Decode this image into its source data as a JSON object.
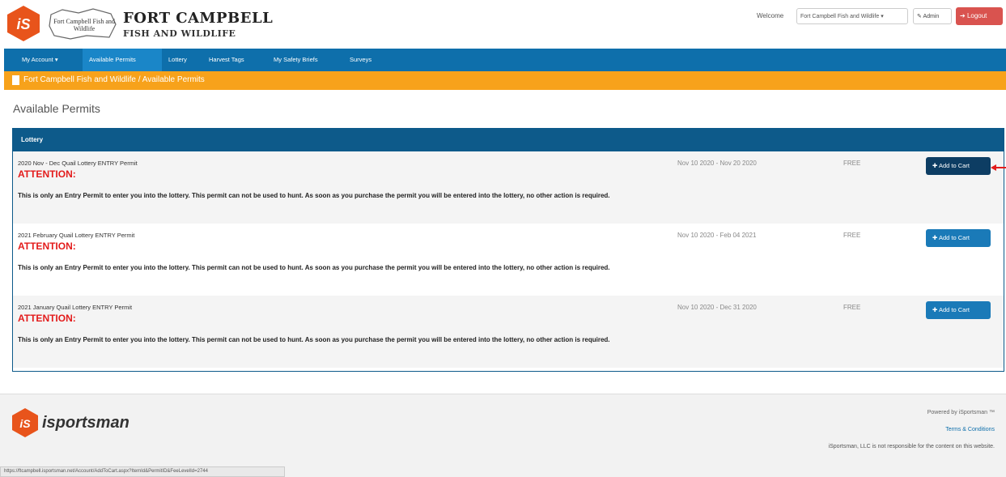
{
  "header": {
    "map_label": "Fort Campbell Fish and Wildlife",
    "title_line1": "FORT CAMPBELL",
    "title_line2": "FISH AND WILDLIFE",
    "welcome_label": "Welcome",
    "account_select": "Fort Campbell Fish and Wildlife ▾",
    "admin_label": "Admin",
    "logout_label": "Logout"
  },
  "nav": {
    "items": [
      "My Account ▾",
      "Available Permits",
      "Lottery",
      "Harvest Tags",
      "My Safety Briefs",
      "Surveys"
    ],
    "active_index": 1
  },
  "breadcrumb": {
    "text": "Fort Campbell Fish and Wildlife  /  Available Permits"
  },
  "page_title": "Available Permits",
  "panel": {
    "heading": "Lottery",
    "rows": [
      {
        "title": "2020 Nov - Dec Quail Lottery ENTRY Permit",
        "attention": "ATTENTION:",
        "description": "This is only an Entry Permit to enter you into the lottery.  This permit can not be used to hunt.  As soon as you purchase the permit you will be entered into the lottery, no other action is required.",
        "dates": "Nov 10 2020 - Nov 20 2020",
        "price": "FREE",
        "button": "Add to Cart"
      },
      {
        "title": "2021 February Quail Lottery ENTRY Permit",
        "attention": "ATTENTION:",
        "description": "This is only an Entry Permit to enter you into the lottery.  This permit can not be used to hunt.  As soon as you purchase the permit you will be entered into the lottery, no other action is required.",
        "dates": "Nov 10 2020 - Feb 04 2021",
        "price": "FREE",
        "button": "Add to Cart"
      },
      {
        "title": "2021 January Quail Lottery ENTRY Permit",
        "attention": "ATTENTION:",
        "description": "This is only an Entry Permit to enter you into the lottery.  This permit can not be used to hunt.  As soon as you purchase the permit you will be entered into the lottery, no other action is required.",
        "dates": "Nov 10 2020 - Dec 31 2020",
        "price": "FREE",
        "button": "Add to Cart"
      }
    ]
  },
  "footer": {
    "brand": "isportsman",
    "powered_by": "Powered by iSportsman ™",
    "terms": "Terms & Conditions",
    "disclaimer": "iSportsman, LLC is not responsible for the content on this website."
  },
  "status_bar": "https://ftcampbell.isportsman.net/Account/AddToCart.aspx?ItemId&PermitID&FeeLevelId=2744",
  "colors": {
    "nav_blue": "#0e6fab",
    "breadcrumb_orange": "#f7a21b",
    "panel_blue": "#0d5a8a",
    "logout_red": "#d9534f",
    "attention_red": "#e31b1b",
    "logo_orange": "#e8541b"
  },
  "icons": {
    "admin": "wrench-icon",
    "logout": "sign-out-icon",
    "breadcrumb": "file-icon",
    "add_to_cart": "plus-icon",
    "annotation": "red-arrow-icon"
  }
}
